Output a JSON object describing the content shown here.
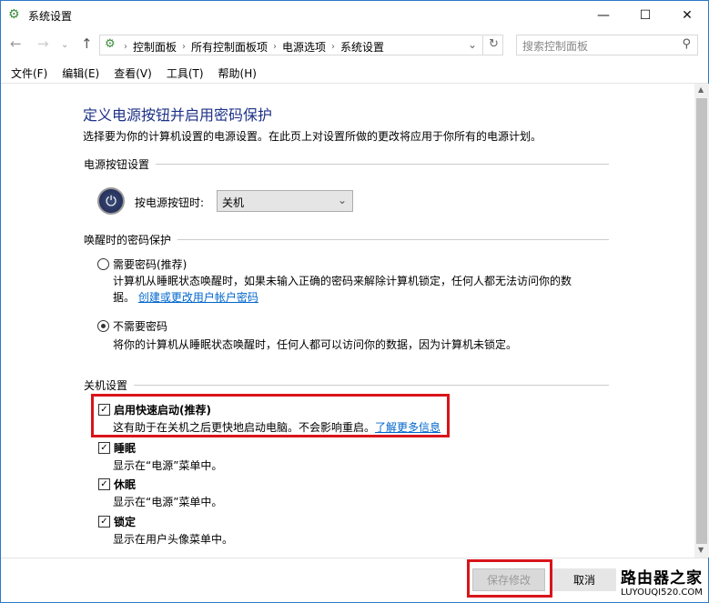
{
  "window": {
    "title": "系统设置",
    "minimize": "—",
    "maximize": "☐",
    "close": "✕"
  },
  "address": {
    "crumbs": [
      "控制面板",
      "所有控制面板项",
      "电源选项",
      "系统设置"
    ],
    "search_placeholder": "搜索控制面板"
  },
  "menu": [
    "文件(F)",
    "编辑(E)",
    "查看(V)",
    "工具(T)",
    "帮助(H)"
  ],
  "page": {
    "heading": "定义电源按钮并启用密码保护",
    "description": "选择要为你的计算机设置的电源设置。在此页上对设置所做的更改将应用于你所有的电源计划。",
    "power_group": "电源按钮设置",
    "power_label": "按电源按钮时:",
    "power_value": "关机",
    "wake_group": "唤醒时的密码保护",
    "opt_require": {
      "label": "需要密码(推荐)",
      "desc1": "计算机从睡眠状态唤醒时，如果未输入正确的密码来解除计算机锁定，任何人都无法访问你的数",
      "desc2": "据。",
      "link": "创建或更改用户帐户密码",
      "selected": false
    },
    "opt_norequire": {
      "label": "不需要密码",
      "desc": "将你的计算机从睡眠状态唤醒时，任何人都可以访问你的数据，因为计算机未锁定。",
      "selected": true
    },
    "shutdown_group": "关机设置",
    "checks": [
      {
        "label": "启用快速启动(推荐)",
        "desc": "这有助于在关机之后更快地启动电脑。不会影响重启。",
        "link": "了解更多信息",
        "checked": true
      },
      {
        "label": "睡眠",
        "desc": "显示在“电源”菜单中。",
        "checked": true
      },
      {
        "label": "休眠",
        "desc": "显示在“电源”菜单中。",
        "checked": true
      },
      {
        "label": "锁定",
        "desc": "显示在用户头像菜单中。",
        "checked": true
      }
    ]
  },
  "footer": {
    "save": "保存修改",
    "cancel": "取消"
  },
  "watermark": {
    "title": "路由器之家",
    "url": "LUYOUQI520.COM"
  },
  "colors": {
    "heading": "#1e3287",
    "link": "#0066cc",
    "highlight": "#d9141b"
  }
}
